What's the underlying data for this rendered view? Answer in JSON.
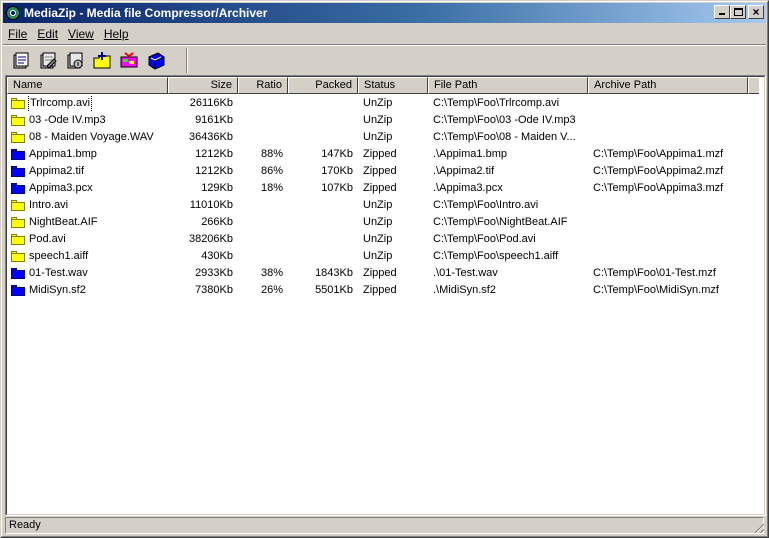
{
  "window": {
    "title": "MediaZip - Media file Compressor/Archiver",
    "controls": {
      "minimize": "minimize",
      "maximize": "maximize",
      "close": "×"
    }
  },
  "menu": [
    {
      "name": "file",
      "label": "File"
    },
    {
      "name": "edit",
      "label": "Edit"
    },
    {
      "name": "view",
      "label": "View"
    },
    {
      "name": "help",
      "label": "Help"
    }
  ],
  "toolbar": {
    "buttons": [
      {
        "name": "properties-button",
        "icon": "properties-icon"
      },
      {
        "name": "edit-properties-button",
        "icon": "edit-properties-icon"
      },
      {
        "name": "info-button",
        "icon": "info-icon"
      },
      {
        "name": "add-files-button",
        "icon": "add-files-icon"
      },
      {
        "name": "compress-button",
        "icon": "compress-icon"
      },
      {
        "name": "archive-button",
        "icon": "archive-icon"
      }
    ]
  },
  "columns": [
    {
      "key": "name",
      "label": "Name"
    },
    {
      "key": "size",
      "label": "Size"
    },
    {
      "key": "ratio",
      "label": "Ratio"
    },
    {
      "key": "packed",
      "label": "Packed"
    },
    {
      "key": "status",
      "label": "Status"
    },
    {
      "key": "file_path",
      "label": "File Path"
    },
    {
      "key": "archive_path",
      "label": "Archive Path"
    }
  ],
  "rows": [
    {
      "name": "Trlrcomp.avi",
      "icon": "yellow",
      "size": "26116Kb",
      "ratio": "",
      "packed": "",
      "status": "UnZip",
      "file_path": "C:\\Temp\\Foo\\Trlrcomp.avi",
      "archive_path": ""
    },
    {
      "name": "03 -Ode IV.mp3",
      "icon": "yellow",
      "size": "9161Kb",
      "ratio": "",
      "packed": "",
      "status": "UnZip",
      "file_path": "C:\\Temp\\Foo\\03 -Ode IV.mp3",
      "archive_path": ""
    },
    {
      "name": "08 - Maiden Voyage.WAV",
      "icon": "yellow",
      "size": "36436Kb",
      "ratio": "",
      "packed": "",
      "status": "UnZip",
      "file_path": "C:\\Temp\\Foo\\08 - Maiden V...",
      "archive_path": ""
    },
    {
      "name": "Appima1.bmp",
      "icon": "blue",
      "size": "1212Kb",
      "ratio": "88%",
      "packed": "147Kb",
      "status": "Zipped",
      "file_path": ".\\Appima1.bmp",
      "archive_path": "C:\\Temp\\Foo\\Appima1.mzf"
    },
    {
      "name": "Appima2.tif",
      "icon": "blue",
      "size": "1212Kb",
      "ratio": "86%",
      "packed": "170Kb",
      "status": "Zipped",
      "file_path": ".\\Appima2.tif",
      "archive_path": "C:\\Temp\\Foo\\Appima2.mzf"
    },
    {
      "name": "Appima3.pcx",
      "icon": "blue",
      "size": "129Kb",
      "ratio": "18%",
      "packed": "107Kb",
      "status": "Zipped",
      "file_path": ".\\Appima3.pcx",
      "archive_path": "C:\\Temp\\Foo\\Appima3.mzf"
    },
    {
      "name": "Intro.avi",
      "icon": "yellow",
      "size": "11010Kb",
      "ratio": "",
      "packed": "",
      "status": "UnZip",
      "file_path": "C:\\Temp\\Foo\\Intro.avi",
      "archive_path": ""
    },
    {
      "name": "NightBeat.AIF",
      "icon": "yellow",
      "size": "266Kb",
      "ratio": "",
      "packed": "",
      "status": "UnZip",
      "file_path": "C:\\Temp\\Foo\\NightBeat.AIF",
      "archive_path": ""
    },
    {
      "name": "Pod.avi",
      "icon": "yellow",
      "size": "38206Kb",
      "ratio": "",
      "packed": "",
      "status": "UnZip",
      "file_path": "C:\\Temp\\Foo\\Pod.avi",
      "archive_path": ""
    },
    {
      "name": "speech1.aiff",
      "icon": "yellow",
      "size": "430Kb",
      "ratio": "",
      "packed": "",
      "status": "UnZip",
      "file_path": "C:\\Temp\\Foo\\speech1.aiff",
      "archive_path": ""
    },
    {
      "name": "01-Test.wav",
      "icon": "blue",
      "size": "2933Kb",
      "ratio": "38%",
      "packed": "1843Kb",
      "status": "Zipped",
      "file_path": ".\\01-Test.wav",
      "archive_path": "C:\\Temp\\Foo\\01-Test.mzf"
    },
    {
      "name": "MidiSyn.sf2",
      "icon": "blue",
      "size": "7380Kb",
      "ratio": "26%",
      "packed": "5501Kb",
      "status": "Zipped",
      "file_path": ".\\MidiSyn.sf2",
      "archive_path": "C:\\Temp\\Foo\\MidiSyn.mzf"
    }
  ],
  "status_bar": {
    "text": "Ready"
  },
  "colors": {
    "titlebar_start": "#0a246a",
    "titlebar_end": "#a6caf0",
    "face": "#d4d0c8",
    "folder_unzipped": "#ffff00",
    "folder_zipped": "#0000ff"
  }
}
